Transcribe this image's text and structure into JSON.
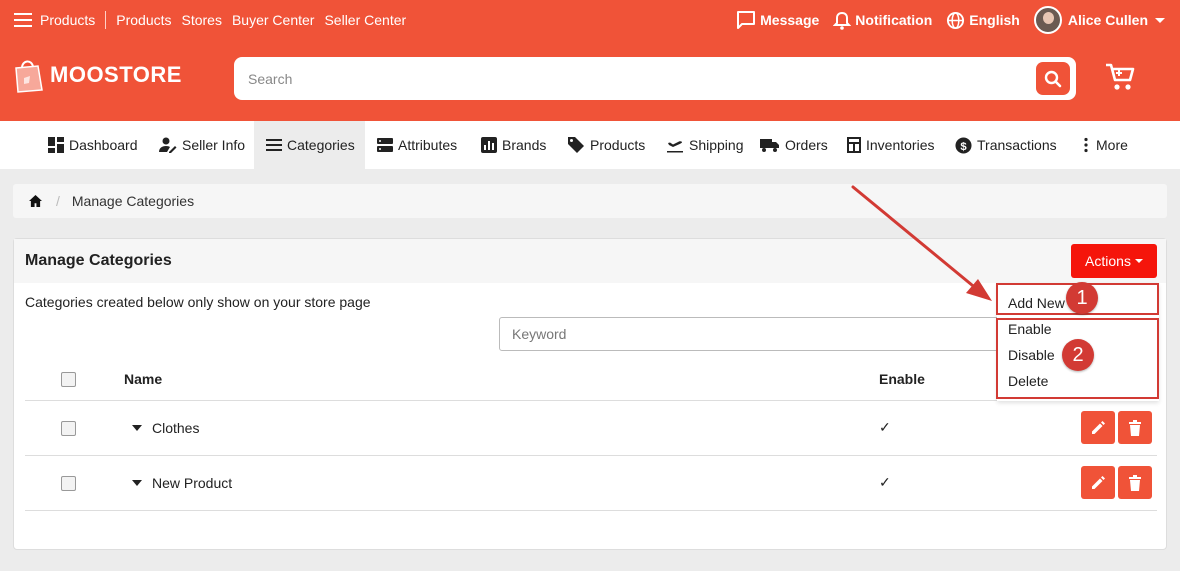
{
  "topbar": {
    "menu_label": "Products",
    "links": [
      "Products",
      "Stores",
      "Buyer Center",
      "Seller Center"
    ],
    "message": "Message",
    "notification": "Notification",
    "language": "English",
    "user_name": "Alice Cullen"
  },
  "header": {
    "logo": "MOOSTORE",
    "search_placeholder": "Search"
  },
  "nav": {
    "items": [
      "Dashboard",
      "Seller Info",
      "Categories",
      "Attributes",
      "Brands",
      "Products",
      "Shipping",
      "Orders",
      "Inventories",
      "Transactions",
      "More"
    ],
    "active": "Categories"
  },
  "breadcrumb": {
    "current": "Manage Categories"
  },
  "panel": {
    "title": "Manage Categories",
    "actions_label": "Actions",
    "note": "Categories created below only show on your store page",
    "keyword_placeholder": "Keyword",
    "columns": {
      "name": "Name",
      "enable": "Enable"
    },
    "rows": [
      {
        "name": "Clothes",
        "enabled": "✓"
      },
      {
        "name": "New Product",
        "enabled": "✓"
      }
    ]
  },
  "dropdown": {
    "options": [
      "Add New",
      "Enable",
      "Disable",
      "Delete"
    ]
  },
  "annotations": {
    "badge1": "1",
    "badge2": "2"
  },
  "colors": {
    "brand": "#f05338",
    "actions": "#f5150b",
    "annotation": "#d23a34"
  }
}
